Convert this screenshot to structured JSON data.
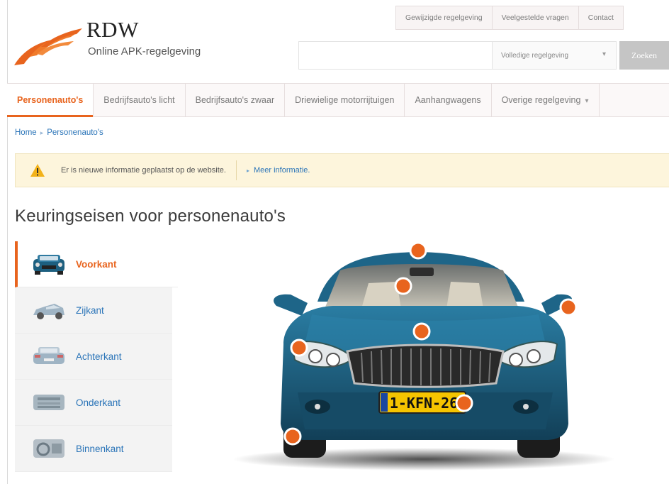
{
  "header": {
    "brand": "RDW",
    "subtitle": "Online APK-regelgeving",
    "top_links": [
      "Gewijzigde regelgeving",
      "Veelgestelde vragen",
      "Contact"
    ]
  },
  "search": {
    "placeholder": "",
    "scope": "Volledige regelgeving",
    "button": "Zoeken"
  },
  "nav": {
    "tabs": [
      {
        "label": "Personenauto's",
        "active": true
      },
      {
        "label": "Bedrijfsauto's licht"
      },
      {
        "label": "Bedrijfsauto's zwaar"
      },
      {
        "label": "Driewielige motorrijtuigen"
      },
      {
        "label": "Aanhangwagens"
      },
      {
        "label": "Overige regelgeving"
      }
    ]
  },
  "breadcrumb": [
    "Home",
    "Personenauto's"
  ],
  "notice": {
    "message": "Er is nieuwe informatie geplaatst op de website.",
    "link": "Meer informatie."
  },
  "page_title": "Keuringseisen voor personenauto's",
  "side_menu": [
    {
      "label": "Voorkant",
      "active": true
    },
    {
      "label": "Zijkant"
    },
    {
      "label": "Achterkant"
    },
    {
      "label": "Onderkant"
    },
    {
      "label": "Binnenkant"
    }
  ],
  "car": {
    "license_plate": "1-KFN-26",
    "accent": "#e8641e",
    "body_color": "#1d5f7f",
    "hotspots": [
      "roof",
      "mirror-interior",
      "mirror-left",
      "mirror-right",
      "hood",
      "headlight-left",
      "license-plate",
      "front-wheel"
    ]
  },
  "colors": {
    "accent": "#e8641e",
    "link": "#2a74b8",
    "notice_bg": "#fdf5dc"
  }
}
